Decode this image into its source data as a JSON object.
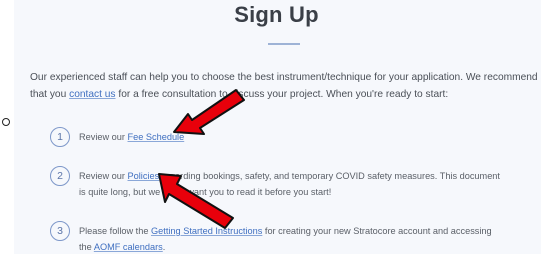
{
  "title": "Sign Up",
  "intro": {
    "line1": "Our experienced staff can help you to choose the best instrument/technique for your application. We recommend",
    "line2_pre": "that you ",
    "contact_link": "contact us",
    "line2_post": " for a free consultation to discuss your project. When you're ready to start:"
  },
  "steps": [
    {
      "number": "1",
      "pre": "Review our ",
      "link": "Fee Schedule",
      "post": ""
    },
    {
      "number": "2",
      "pre": "Review our ",
      "link": "Policies",
      "post": " regarding bookings, safety, and temporary COVID safety measures. This document",
      "line2": "is quite long, but we really want you to read it before you start!"
    },
    {
      "number": "3",
      "pre": "Please follow the ",
      "link": "Getting Started Instructions",
      "post": " for creating your new Stratocore account and accessing",
      "line2_pre": "the ",
      "line2_link": "AOMF calendars",
      "line2_post": "."
    }
  ],
  "colors": {
    "accent": "#3f6fc0",
    "arrow_fill": "#e8000b",
    "panel": "#f6f8fc"
  }
}
